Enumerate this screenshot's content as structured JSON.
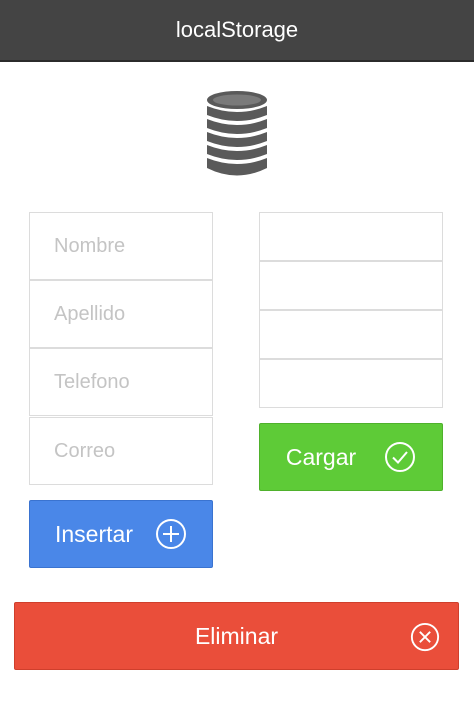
{
  "header": {
    "title": "localStorage"
  },
  "icons": {
    "app": "database-icon",
    "insert": "plus-circle-icon",
    "load": "check-circle-icon",
    "delete": "x-circle-icon"
  },
  "form": {
    "fields": [
      {
        "placeholder": "Nombre",
        "value": ""
      },
      {
        "placeholder": "Apellido",
        "value": ""
      },
      {
        "placeholder": "Telefono",
        "value": ""
      },
      {
        "placeholder": "Correo",
        "value": ""
      }
    ]
  },
  "output": {
    "rows": [
      "",
      "",
      "",
      ""
    ]
  },
  "buttons": {
    "insert": "Insertar",
    "load": "Cargar",
    "delete": "Eliminar"
  },
  "colors": {
    "header": "#444444",
    "insert": "#4a87e8",
    "load": "#5ecb37",
    "delete": "#ea4e3a",
    "icon": "#5a5a5a"
  }
}
